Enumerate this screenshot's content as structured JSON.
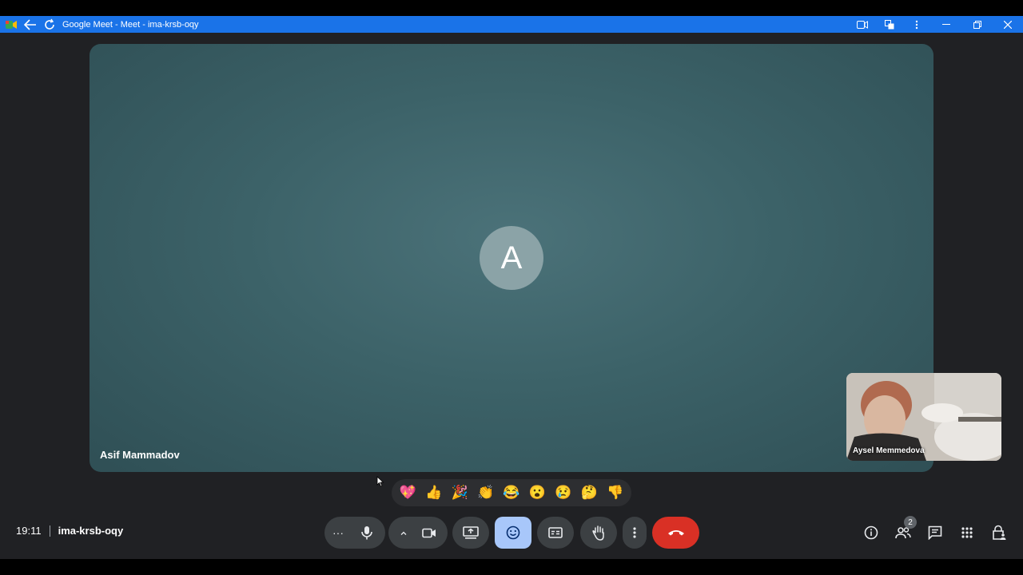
{
  "window": {
    "title": "Google Meet - Meet - ima-krsb-oqy",
    "icons": [
      "meet-logo-icon",
      "back-arrow-icon",
      "reload-icon",
      "camera-icon",
      "translate-icon",
      "kebab-menu-icon",
      "minimize-icon",
      "restore-icon",
      "close-icon"
    ]
  },
  "main_participant": {
    "name": "Asif Mammadov",
    "initial": "A"
  },
  "self_view": {
    "name": "Aysel Memmedova"
  },
  "reactions": [
    "💖",
    "👍",
    "🎉",
    "👏",
    "😂",
    "😮",
    "😢",
    "🤔",
    "👎"
  ],
  "meeting": {
    "time": "19:11",
    "code": "ima-krsb-oqy"
  },
  "controls": {
    "more_dots": "···",
    "participants_count": "2"
  },
  "colors": {
    "titlebar": "#1a73e8",
    "end_call": "#d93025",
    "active_reaction": "#a8c7fa",
    "tile": "#3c6268"
  }
}
